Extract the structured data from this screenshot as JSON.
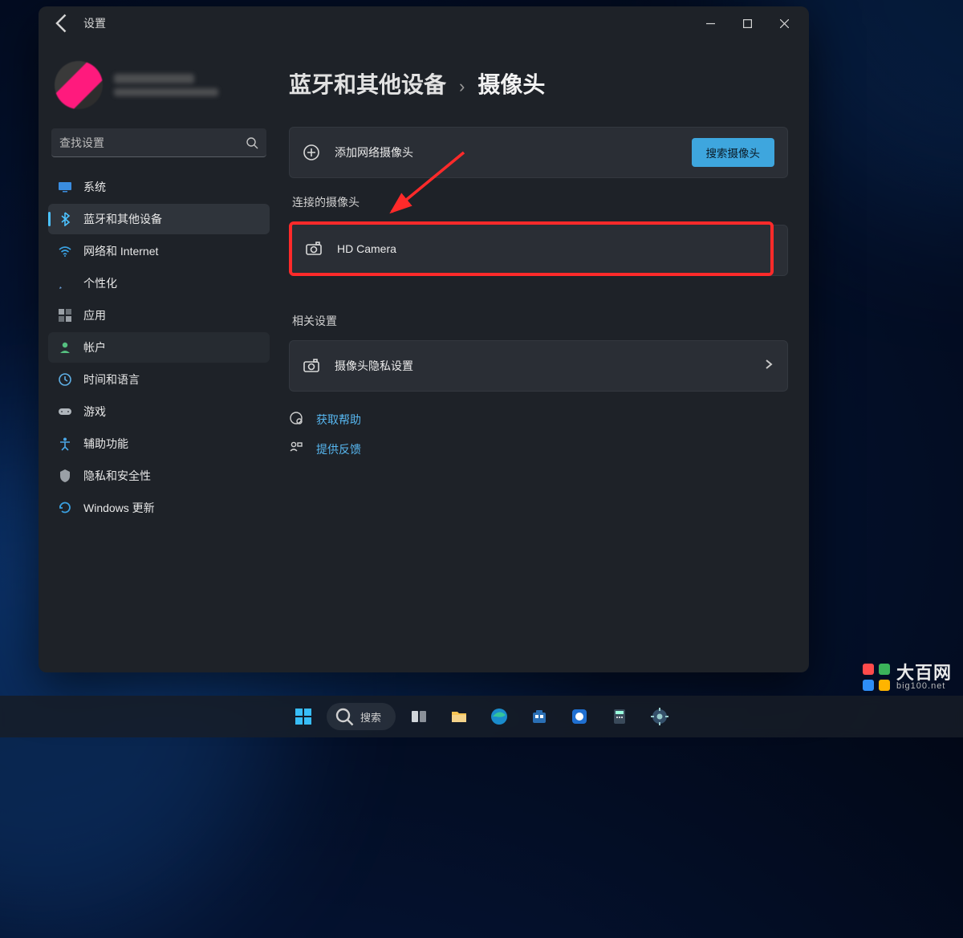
{
  "titlebar": {
    "title": "设置"
  },
  "search": {
    "placeholder": "查找设置"
  },
  "sidebar": {
    "items": [
      {
        "label": "系统"
      },
      {
        "label": "蓝牙和其他设备"
      },
      {
        "label": "网络和 Internet"
      },
      {
        "label": "个性化"
      },
      {
        "label": "应用"
      },
      {
        "label": "帐户"
      },
      {
        "label": "时间和语言"
      },
      {
        "label": "游戏"
      },
      {
        "label": "辅助功能"
      },
      {
        "label": "隐私和安全性"
      },
      {
        "label": "Windows 更新"
      }
    ]
  },
  "breadcrumb": {
    "parent": "蓝牙和其他设备",
    "current": "摄像头"
  },
  "add_row": {
    "label": "添加网络摄像头",
    "button": "搜索摄像头"
  },
  "sections": {
    "connected": "连接的摄像头",
    "related": "相关设置"
  },
  "camera_item": {
    "label": "HD Camera"
  },
  "privacy_item": {
    "label": "摄像头隐私设置"
  },
  "links": {
    "help": "获取帮助",
    "feedback": "提供反馈"
  },
  "taskbar": {
    "search": "搜索"
  },
  "watermark": {
    "name": "大百网",
    "domain": "big100.net"
  },
  "colors": {
    "accent": "#4cc2ff",
    "highlight": "#ff2a2a",
    "button": "#3ea6de"
  }
}
